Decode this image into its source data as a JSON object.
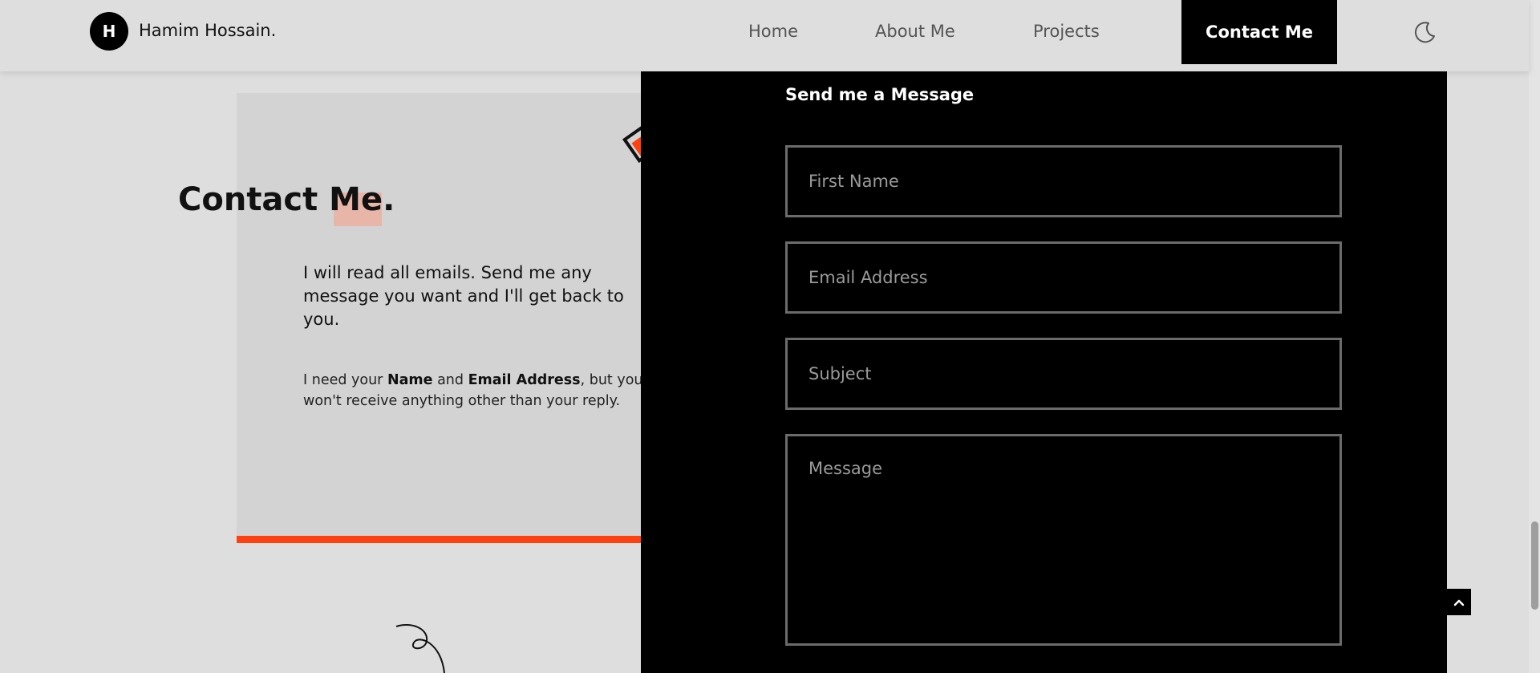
{
  "header": {
    "logo_letter": "H",
    "brand_name": "Hamim Hossain.",
    "nav": {
      "home": "Home",
      "about": "About Me",
      "projects": "Projects",
      "contact": "Contact Me"
    },
    "theme_icon": "moon-icon"
  },
  "contact": {
    "title": "Contact Me.",
    "lead": "I will read all emails. Send me any message you want and I'll get back to you.",
    "note_prefix": "I need your ",
    "note_name": "Name",
    "note_and": " and ",
    "note_email": "Email Address",
    "note_suffix": ", but you won't receive anything other than your reply."
  },
  "form": {
    "heading": "Send me a Message",
    "first_name_placeholder": "First Name",
    "email_placeholder": "Email Address",
    "subject_placeholder": "Subject",
    "message_placeholder": "Message",
    "first_name_value": "",
    "email_value": "",
    "subject_value": "",
    "message_value": ""
  },
  "icons": {
    "scroll_top": "chevron-up-icon",
    "decoration": "diamond-square-icon",
    "squiggle": "squiggle-decoration-icon"
  },
  "colors": {
    "accent": "#ff4011",
    "background": "#dedede",
    "card": "#d3d3d3",
    "panel": "#000000",
    "highlight": "#e8b6a8"
  }
}
